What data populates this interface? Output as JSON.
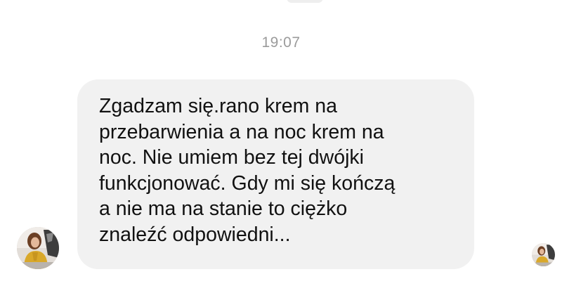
{
  "conversation": {
    "timestamp": "19:07",
    "message": {
      "text": "Zgadzam się.rano krem na\nprzebarwienia a na noc krem na\nnoc. Nie umiem bez tej dwójki\nfunkcjonować. Gdy mi się kończą\na nie ma na stanie to ciężko\nznaleźć odpowiedni..."
    },
    "sender_avatar": {
      "icon": "profile-photo-icon"
    },
    "read_receipt": {
      "icon": "read-receipt-avatar-icon"
    }
  },
  "colors": {
    "bubble_background": "#f1f1f1",
    "timestamp_text": "#9b9b9b",
    "message_text": "#111111"
  }
}
